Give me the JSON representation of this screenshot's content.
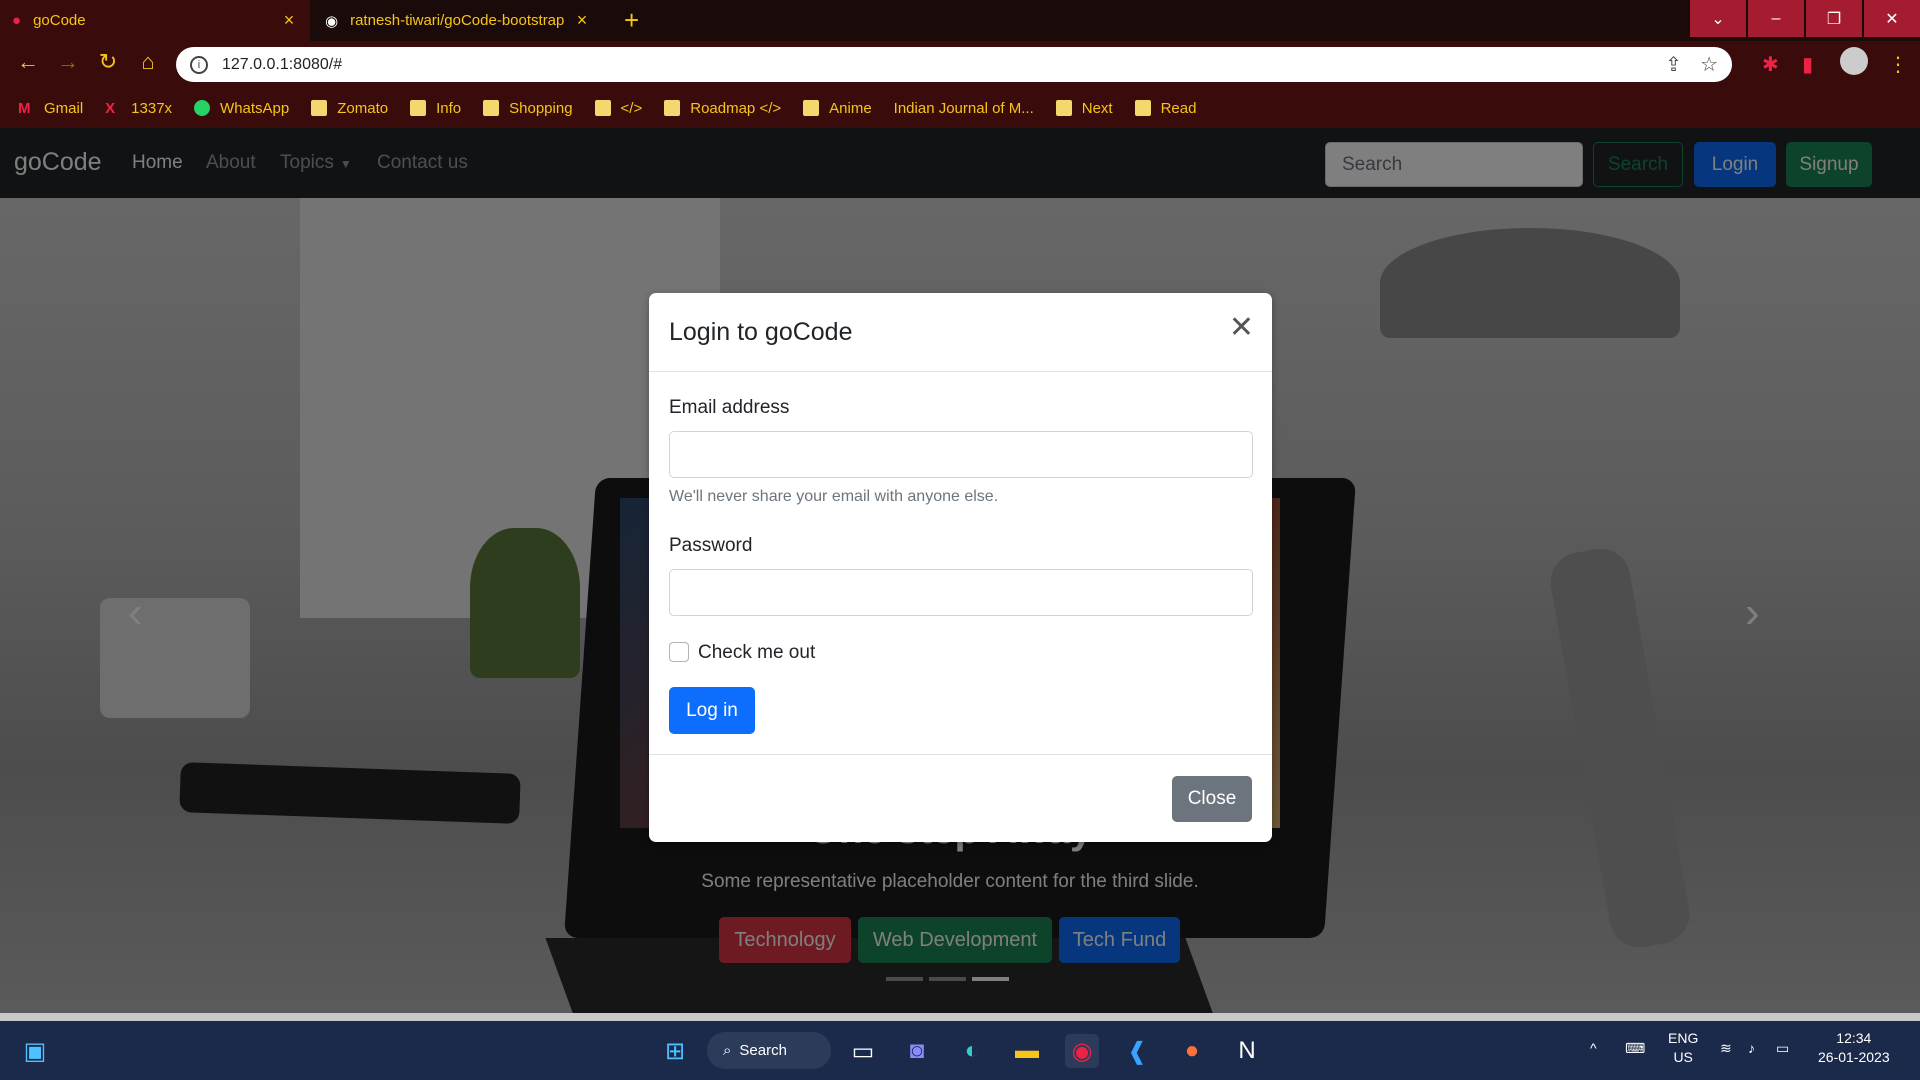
{
  "browser": {
    "tabs": [
      {
        "title": "goCode",
        "close": "×"
      },
      {
        "title": "ratnesh-tiwari/goCode-bootstrap",
        "close": "×"
      }
    ],
    "new_tab": "+",
    "url": "127.0.0.1:8080/#",
    "bookmarks": [
      "Gmail",
      "1337x",
      "WhatsApp",
      "Zomato",
      "Info",
      "Shopping",
      "</>",
      "Roadmap </>",
      "Anime",
      "Indian Journal of M...",
      "Next",
      "Read"
    ]
  },
  "site": {
    "brand": "goCode",
    "nav": [
      "Home",
      "About",
      "Topics",
      "Contact us"
    ],
    "search_placeholder": "Search",
    "search_button": "Search",
    "login_button": "Login",
    "signup_button": "Signup",
    "carousel": {
      "title": "One step Away",
      "text": "Some representative placeholder content for the third slide.",
      "buttons": [
        "Technology",
        "Web Development",
        "Tech Fund"
      ]
    }
  },
  "modal": {
    "title": "Login to goCode",
    "email_label": "Email address",
    "email_help": "We'll never share your email with anyone else.",
    "password_label": "Password",
    "checkbox_label": "Check me out",
    "submit": "Log in",
    "close": "Close"
  },
  "taskbar": {
    "search": "Search",
    "lang1": "ENG",
    "lang2": "US",
    "time": "12:34",
    "date": "26-01-2023"
  },
  "colors": {
    "primary": "#0d6efd",
    "success": "#198754",
    "danger": "#dc3545",
    "secondary": "#6c757d",
    "browser_dark": "#3a0b0b",
    "accent": "#f5c518"
  }
}
